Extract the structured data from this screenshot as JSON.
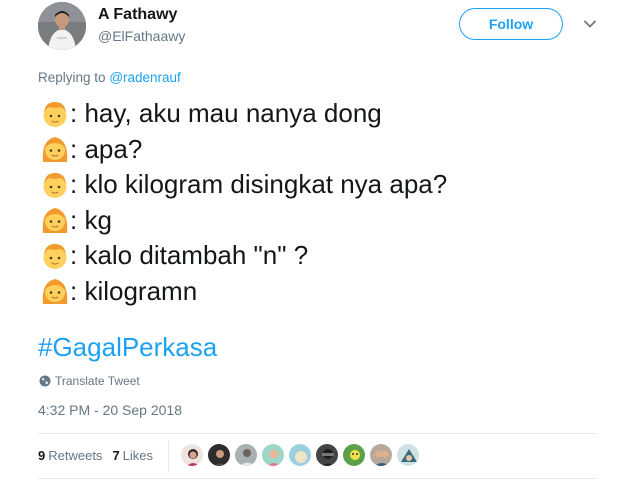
{
  "user": {
    "display_name": "A Fathawy",
    "handle": "@ElFathaawy",
    "avatar_icon": "user-avatar"
  },
  "follow_button": {
    "label": "Follow",
    "color": "#1da1f2"
  },
  "menu_icon": "chevron-down-icon",
  "reply_context": {
    "prefix": "Replying to",
    "mention": "@radenrauf"
  },
  "tweet_lines": [
    {
      "speaker_emoji": "boy-face-emoji",
      "text": ": hay, aku mau nanya dong"
    },
    {
      "speaker_emoji": "girl-face-emoji",
      "text": ": apa?"
    },
    {
      "speaker_emoji": "boy-face-emoji",
      "text": ": klo kilogram disingkat nya apa?"
    },
    {
      "speaker_emoji": "girl-face-emoji",
      "text": ": kg"
    },
    {
      "speaker_emoji": "boy-face-emoji",
      "text": ": kalo ditambah \"n\" ?"
    },
    {
      "speaker_emoji": "girl-face-emoji",
      "text": ": kilogramn"
    }
  ],
  "hashtag": "#GagalPerkasa",
  "translate": {
    "label": "Translate Tweet",
    "icon": "globe-icon"
  },
  "timestamp": "4:32 PM - 20 Sep 2018",
  "stats": {
    "retweets_count": "9",
    "retweets_label": "Retweets",
    "likes_count": "7",
    "likes_label": "Likes"
  },
  "likers": [
    {
      "icon": "liker-avatar-1"
    },
    {
      "icon": "liker-avatar-2"
    },
    {
      "icon": "liker-avatar-3"
    },
    {
      "icon": "liker-avatar-4"
    },
    {
      "icon": "liker-avatar-5"
    },
    {
      "icon": "liker-avatar-6"
    },
    {
      "icon": "liker-avatar-7"
    },
    {
      "icon": "liker-avatar-8"
    },
    {
      "icon": "liker-avatar-9"
    }
  ],
  "colors": {
    "accent": "#1da1f2",
    "text_primary": "#14171a",
    "text_secondary": "#657786",
    "divider": "#e6ecf0"
  }
}
